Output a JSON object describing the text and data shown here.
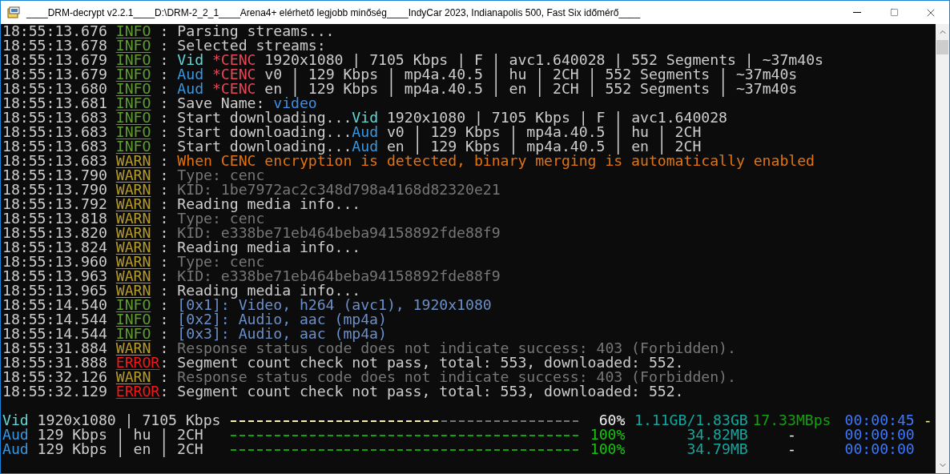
{
  "window": {
    "title": "____DRM-decrypt v2.2.1____D:\\DRM-2_2_1____Arena4+ elérhető legjobb minőség____IndyCar 2023, Indianapolis 500, Fast Six időmérő____"
  },
  "log": [
    {
      "time": "18:55:13.676",
      "level": "INFO",
      "kind": "info",
      "sep": ":",
      "parts": [
        {
          "text": "Parsing streams...",
          "kind": "plain"
        }
      ]
    },
    {
      "time": "18:55:13.678",
      "level": "INFO",
      "kind": "info",
      "sep": ":",
      "parts": [
        {
          "text": "Selected streams:",
          "kind": "plain"
        }
      ]
    },
    {
      "time": "18:55:13.679",
      "level": "INFO",
      "kind": "info",
      "sep": ":",
      "parts": [
        {
          "text": "Vid",
          "kind": "vid"
        },
        {
          "text": " *CENC",
          "kind": "cenc"
        },
        {
          "text": " 1920x1080 | 7105 Kbps | F | avc1.640028 | 552 Segments | ~37m40s",
          "kind": "plain"
        }
      ]
    },
    {
      "time": "18:55:13.679",
      "level": "INFO",
      "kind": "info",
      "sep": ":",
      "parts": [
        {
          "text": "Aud",
          "kind": "aud"
        },
        {
          "text": " *CENC",
          "kind": "cenc"
        },
        {
          "text": " v0 | 129 Kbps | mp4a.40.5 | hu | 2CH | 552 Segments | ~37m40s",
          "kind": "plain"
        }
      ]
    },
    {
      "time": "18:55:13.680",
      "level": "INFO",
      "kind": "info",
      "sep": ":",
      "parts": [
        {
          "text": "Aud",
          "kind": "aud"
        },
        {
          "text": " *CENC",
          "kind": "cenc"
        },
        {
          "text": " en | 129 Kbps | mp4a.40.5 | en | 2CH | 552 Segments | ~37m40s",
          "kind": "plain"
        }
      ]
    },
    {
      "time": "18:55:13.681",
      "level": "INFO",
      "kind": "info",
      "sep": ":",
      "parts": [
        {
          "text": "Save Name: ",
          "kind": "plain"
        },
        {
          "text": "video",
          "kind": "name"
        }
      ]
    },
    {
      "time": "18:55:13.683",
      "level": "INFO",
      "kind": "info",
      "sep": ":",
      "parts": [
        {
          "text": "Start downloading...",
          "kind": "plain"
        },
        {
          "text": "Vid",
          "kind": "vid"
        },
        {
          "text": " 1920x1080 | 7105 Kbps | F | avc1.640028",
          "kind": "plain"
        }
      ]
    },
    {
      "time": "18:55:13.683",
      "level": "INFO",
      "kind": "info",
      "sep": ":",
      "parts": [
        {
          "text": "Start downloading...",
          "kind": "plain"
        },
        {
          "text": "Aud",
          "kind": "aud"
        },
        {
          "text": " v0 | 129 Kbps | mp4a.40.5 | hu | 2CH",
          "kind": "plain"
        }
      ]
    },
    {
      "time": "18:55:13.683",
      "level": "INFO",
      "kind": "info",
      "sep": ":",
      "parts": [
        {
          "text": "Start downloading...",
          "kind": "plain"
        },
        {
          "text": "Aud",
          "kind": "aud"
        },
        {
          "text": " en | 129 Kbps | mp4a.40.5 | en | 2CH",
          "kind": "plain"
        }
      ]
    },
    {
      "time": "18:55:13.683",
      "level": "WARN",
      "kind": "warn",
      "sep": ":",
      "parts": [
        {
          "text": "When CENC encryption is detected, binary merging is automatically enabled",
          "kind": "warning"
        }
      ]
    },
    {
      "time": "18:55:13.790",
      "level": "WARN",
      "kind": "warn",
      "sep": ":",
      "parts": [
        {
          "text": "Type: cenc",
          "kind": "dim"
        }
      ]
    },
    {
      "time": "18:55:13.790",
      "level": "WARN",
      "kind": "warn",
      "sep": ":",
      "parts": [
        {
          "text": "KID: 1be7972ac2c348d798a4168d82320e21",
          "kind": "dim"
        }
      ]
    },
    {
      "time": "18:55:13.792",
      "level": "WARN",
      "kind": "warn",
      "sep": ":",
      "parts": [
        {
          "text": "Reading media info...",
          "kind": "plain"
        }
      ]
    },
    {
      "time": "18:55:13.818",
      "level": "WARN",
      "kind": "warn",
      "sep": ":",
      "parts": [
        {
          "text": "Type: cenc",
          "kind": "dim"
        }
      ]
    },
    {
      "time": "18:55:13.820",
      "level": "WARN",
      "kind": "warn",
      "sep": ":",
      "parts": [
        {
          "text": "KID: e338be71eb464beba94158892fde88f9",
          "kind": "dim"
        }
      ]
    },
    {
      "time": "18:55:13.824",
      "level": "WARN",
      "kind": "warn",
      "sep": ":",
      "parts": [
        {
          "text": "Reading media info...",
          "kind": "plain"
        }
      ]
    },
    {
      "time": "18:55:13.960",
      "level": "WARN",
      "kind": "warn",
      "sep": ":",
      "parts": [
        {
          "text": "Type: cenc",
          "kind": "dim"
        }
      ]
    },
    {
      "time": "18:55:13.963",
      "level": "WARN",
      "kind": "warn",
      "sep": ":",
      "parts": [
        {
          "text": "KID: e338be71eb464beba94158892fde88f9",
          "kind": "dim"
        }
      ]
    },
    {
      "time": "18:55:13.965",
      "level": "WARN",
      "kind": "warn",
      "sep": ":",
      "parts": [
        {
          "text": "Reading media info...",
          "kind": "plain"
        }
      ]
    },
    {
      "time": "18:55:14.540",
      "level": "INFO",
      "kind": "info",
      "sep": ":",
      "parts": [
        {
          "text": "[0x1]: Video, h264 (avc1), 1920x1080",
          "kind": "stream"
        }
      ]
    },
    {
      "time": "18:55:14.544",
      "level": "INFO",
      "kind": "info",
      "sep": ":",
      "parts": [
        {
          "text": "[0x2]: Audio, aac (mp4a)",
          "kind": "stream"
        }
      ]
    },
    {
      "time": "18:55:14.544",
      "level": "INFO",
      "kind": "info",
      "sep": ":",
      "parts": [
        {
          "text": "[0x3]: Audio, aac (mp4a)",
          "kind": "stream"
        }
      ]
    },
    {
      "time": "18:55:31.884",
      "level": "WARN",
      "kind": "warn",
      "sep": ":",
      "parts": [
        {
          "text": "Response status code does not indicate success: 403 (Forbidden).",
          "kind": "dim"
        }
      ]
    },
    {
      "time": "18:55:31.888",
      "level": "ERROR",
      "kind": "error",
      "sep": ":",
      "parts": [
        {
          "text": "Segment count check not pass, total: 553, downloaded: 552.",
          "kind": "plain"
        }
      ]
    },
    {
      "time": "18:55:32.126",
      "level": "WARN",
      "kind": "warn",
      "sep": ":",
      "parts": [
        {
          "text": "Response status code does not indicate success: 403 (Forbidden).",
          "kind": "dim"
        }
      ]
    },
    {
      "time": "18:55:32.129",
      "level": "ERROR",
      "kind": "error",
      "sep": ":",
      "parts": [
        {
          "text": "Segment count check not pass, total: 553, downloaded: 552.",
          "kind": "plain"
        }
      ]
    }
  ],
  "progress": [
    {
      "parts": [
        {
          "text": "Vid",
          "kind": "vid"
        },
        {
          "text": " 1920x1080 | 7105 Kbps",
          "kind": "plain"
        }
      ],
      "level": 0.6,
      "done": false,
      "percent": "60%",
      "size": "1.11GB/1.83GB",
      "speed": "17.33MBps",
      "eta": "00:00:45",
      "spinner": "-"
    },
    {
      "parts": [
        {
          "text": "Aud",
          "kind": "aud"
        },
        {
          "text": " 129 Kbps | hu | 2CH",
          "kind": "plain"
        }
      ],
      "level": 1,
      "done": true,
      "percent": "100%",
      "size": "34.82MB",
      "speed": "-",
      "eta": "00:00:00"
    },
    {
      "parts": [
        {
          "text": "Aud",
          "kind": "aud"
        },
        {
          "text": " 129 Kbps | en | 2CH",
          "kind": "plain"
        }
      ],
      "level": 1,
      "done": true,
      "percent": "100%",
      "size": "34.79MB",
      "speed": "-",
      "eta": "00:00:00"
    }
  ]
}
